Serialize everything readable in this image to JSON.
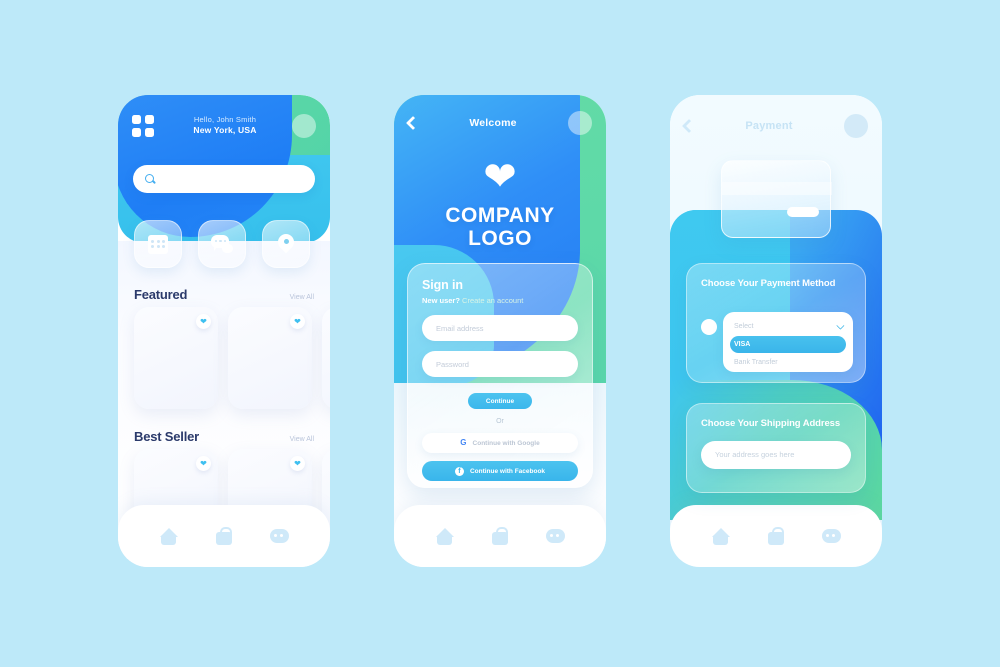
{
  "page": {
    "background_color": "#bde9f9"
  },
  "phone1": {
    "name": "home-screen",
    "header": {
      "menu_icon": "grid-menu-icon",
      "greeting": "Hello, John Smith",
      "location": "New York, USA",
      "avatar": "user-avatar"
    },
    "search": {
      "placeholder": "",
      "icon": "search-icon"
    },
    "tiles": [
      {
        "icon": "calendar-icon",
        "label": ""
      },
      {
        "icon": "chat-icon",
        "label": ""
      },
      {
        "icon": "location-pin-icon",
        "label": ""
      }
    ],
    "sections": [
      {
        "title": "Featured",
        "view_all": "View All",
        "cards": 3
      },
      {
        "title": "Best Seller",
        "view_all": "View All",
        "cards": 3
      }
    ],
    "card_favorite_icon": "heart-icon",
    "nav": [
      {
        "icon": "home-icon"
      },
      {
        "icon": "bag-icon"
      },
      {
        "icon": "chat-icon"
      }
    ]
  },
  "phone2": {
    "name": "welcome-signin-screen",
    "header": {
      "back_icon": "back-chevron-icon",
      "title": "Welcome",
      "avatar": "user-avatar"
    },
    "logo": {
      "icon": "heart-logo-icon",
      "line1": "COMPANY",
      "line2": "LOGO"
    },
    "signin": {
      "title": "Sign in",
      "new_user_text": "New user?",
      "create_account_link": "Create an account",
      "email_placeholder": "Email address",
      "password_placeholder": "Password",
      "continue_label": "Continue",
      "or_label": "Or",
      "google_label": "Continue with Google",
      "google_icon": "google-icon",
      "facebook_label": "Continue with Facebook",
      "facebook_icon": "facebook-icon"
    },
    "nav": [
      {
        "icon": "home-icon"
      },
      {
        "icon": "bag-icon"
      },
      {
        "icon": "chat-icon"
      }
    ]
  },
  "phone3": {
    "name": "payment-screen",
    "header": {
      "back_icon": "back-chevron-icon",
      "title": "Payment",
      "avatar": "user-avatar"
    },
    "card_graphic": "credit-card-icon",
    "payment": {
      "title": "Choose Your Payment Method",
      "radio": "payment-radio",
      "select_placeholder": "Select",
      "chevron_icon": "chevron-down-icon",
      "options": [
        {
          "label": "VISA",
          "selected": true
        },
        {
          "label": "Bank Transfer",
          "selected": false
        }
      ]
    },
    "shipping": {
      "title": "Choose Your Shipping Address",
      "address_placeholder": "Your address goes here"
    },
    "nav": [
      {
        "icon": "home-icon"
      },
      {
        "icon": "bag-icon"
      },
      {
        "icon": "chat-icon"
      }
    ]
  },
  "colors": {
    "blue": "#2486f6",
    "cyan": "#3fc6ef",
    "green": "#5cd89f",
    "accent": "#3bb7ec",
    "title_navy": "#2b3a6b",
    "muted": "#b9c4da"
  }
}
